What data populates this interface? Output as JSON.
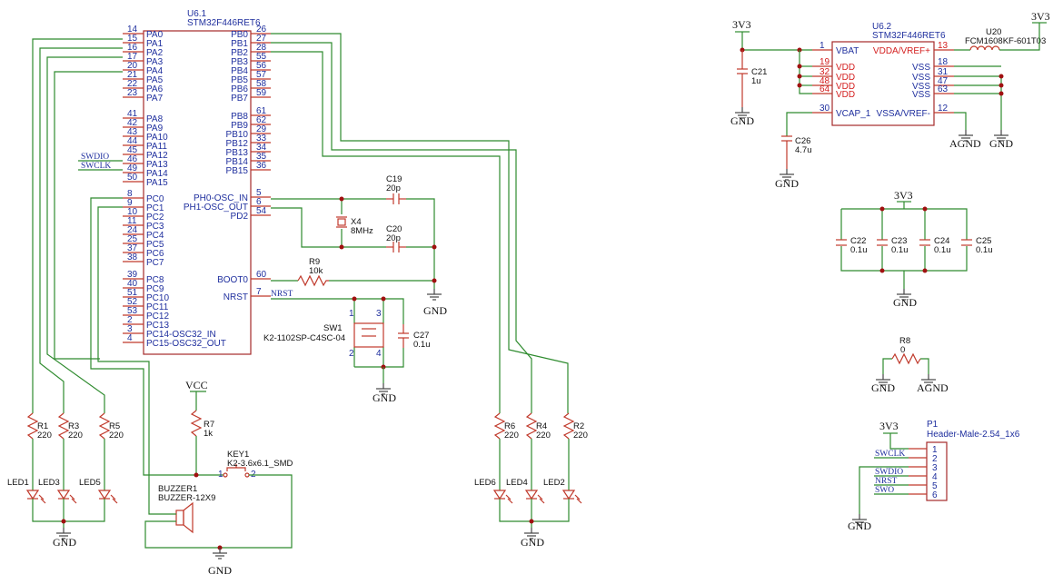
{
  "u61": {
    "ref": "U6.1",
    "part": "STM32F446RET6",
    "left": [
      [
        "14",
        "PA0"
      ],
      [
        "15",
        "PA1"
      ],
      [
        "16",
        "PA2"
      ],
      [
        "17",
        "PA3"
      ],
      [
        "20",
        "PA4"
      ],
      [
        "21",
        "PA5"
      ],
      [
        "22",
        "PA6"
      ],
      [
        "23",
        "PA7"
      ],
      [
        "41",
        "PA8"
      ],
      [
        "42",
        "PA9"
      ],
      [
        "43",
        "PA10"
      ],
      [
        "44",
        "PA11"
      ],
      [
        "45",
        "PA12"
      ],
      [
        "46",
        "PA13"
      ],
      [
        "49",
        "PA14"
      ],
      [
        "50",
        "PA15"
      ],
      [
        "8",
        "PC0"
      ],
      [
        "9",
        "PC1"
      ],
      [
        "10",
        "PC2"
      ],
      [
        "11",
        "PC3"
      ],
      [
        "24",
        "PC4"
      ],
      [
        "25",
        "PC5"
      ],
      [
        "37",
        "PC6"
      ],
      [
        "38",
        "PC7"
      ],
      [
        "39",
        "PC8"
      ],
      [
        "40",
        "PC9"
      ],
      [
        "51",
        "PC10"
      ],
      [
        "52",
        "PC11"
      ],
      [
        "53",
        "PC12"
      ],
      [
        "2",
        "PC13"
      ],
      [
        "3",
        "PC14-OSC32_IN"
      ],
      [
        "4",
        "PC15-OSC32_OUT"
      ]
    ],
    "right": [
      [
        "26",
        "PB0"
      ],
      [
        "27",
        "PB1"
      ],
      [
        "28",
        "PB2"
      ],
      [
        "55",
        "PB3"
      ],
      [
        "56",
        "PB4"
      ],
      [
        "57",
        "PB5"
      ],
      [
        "58",
        "PB6"
      ],
      [
        "59",
        "PB7"
      ],
      [
        "61",
        "PB8"
      ],
      [
        "62",
        "PB9"
      ],
      [
        "29",
        "PB10"
      ],
      [
        "33",
        "PB12"
      ],
      [
        "34",
        "PB13"
      ],
      [
        "35",
        "PB14"
      ],
      [
        "36",
        "PB15"
      ],
      [
        "5",
        "PH0-OSC_IN"
      ],
      [
        "6",
        "PH1-OSC_OUT"
      ],
      [
        "54",
        "PD2"
      ],
      [
        "60",
        "BOOT0"
      ],
      [
        "7",
        "NRST"
      ]
    ]
  },
  "u62": {
    "ref": "U6.2",
    "part": "STM32F446RET6",
    "left": [
      [
        "1",
        "VBAT"
      ],
      [
        "19",
        "VDD"
      ],
      [
        "32",
        "VDD"
      ],
      [
        "48",
        "VDD"
      ],
      [
        "64",
        "VDD"
      ],
      [
        "30",
        "VCAP_1"
      ]
    ],
    "right": [
      [
        "13",
        "VDDA/VREF+"
      ],
      [
        "18",
        "VSS"
      ],
      [
        "31",
        "VSS"
      ],
      [
        "47",
        "VSS"
      ],
      [
        "63",
        "VSS"
      ],
      [
        "12",
        "VSSA/VREF-"
      ]
    ]
  },
  "nets": {
    "swdio": "SWDIO",
    "swclk": "SWCLK",
    "nrst": "NRST",
    "swo": "SWO"
  },
  "power": {
    "gnd": "GND",
    "agnd": "AGND",
    "v33": "3V3",
    "vcc": "VCC"
  },
  "parts": {
    "c19": {
      "ref": "C19",
      "val": "20p"
    },
    "c20": {
      "ref": "C20",
      "val": "20p"
    },
    "x4": {
      "ref": "X4",
      "val": "8MHz"
    },
    "r9": {
      "ref": "R9",
      "val": "10k"
    },
    "sw1": {
      "ref": "SW1",
      "val": "K2-1102SP-C4SC-04",
      "p1": "1",
      "p2": "2",
      "p3": "3",
      "p4": "4"
    },
    "c27": {
      "ref": "C27",
      "val": "0.1u"
    },
    "c21": {
      "ref": "C21",
      "val": "1u"
    },
    "c26": {
      "ref": "C26",
      "val": "4.7u"
    },
    "u20": {
      "ref": "U20",
      "val": "FCM1608KF-601T03"
    },
    "c22": {
      "ref": "C22",
      "val": "0.1u"
    },
    "c23": {
      "ref": "C23",
      "val": "0.1u"
    },
    "c24": {
      "ref": "C24",
      "val": "0.1u"
    },
    "c25": {
      "ref": "C25",
      "val": "0.1u"
    },
    "r8": {
      "ref": "R8",
      "val": "0"
    },
    "p1": {
      "ref": "P1",
      "val": "Header-Male-2.54_1x6",
      "pins": [
        "1",
        "2",
        "3",
        "4",
        "5",
        "6"
      ]
    },
    "r1": {
      "ref": "R1",
      "val": "220"
    },
    "r3": {
      "ref": "R3",
      "val": "220"
    },
    "r5": {
      "ref": "R5",
      "val": "220"
    },
    "r6": {
      "ref": "R6",
      "val": "220"
    },
    "r4": {
      "ref": "R4",
      "val": "220"
    },
    "r2": {
      "ref": "R2",
      "val": "220"
    },
    "r7": {
      "ref": "R7",
      "val": "1k"
    },
    "led1": "LED1",
    "led3": "LED3",
    "led5": "LED5",
    "led6": "LED6",
    "led4": "LED4",
    "led2": "LED2",
    "key1": {
      "ref": "KEY1",
      "val": "K2-3.6x6.1_SMD",
      "p1": "1",
      "p2": "2"
    },
    "buzzer1": {
      "ref": "BUZZER1",
      "val": "BUZZER-12X9"
    }
  }
}
